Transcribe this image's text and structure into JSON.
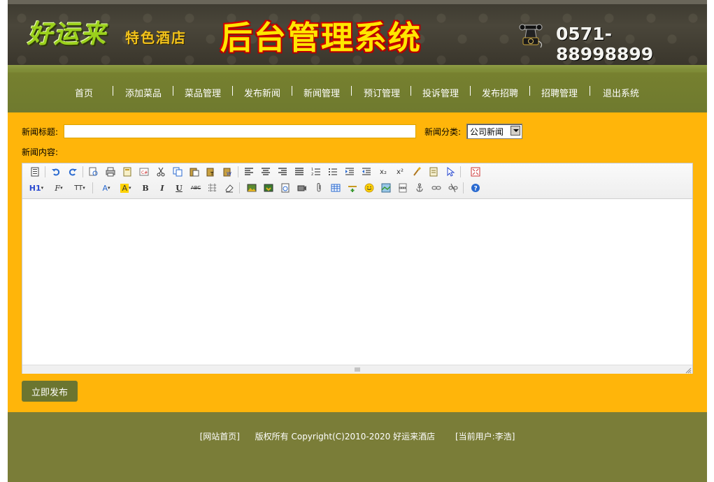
{
  "header": {
    "brand": "好运来",
    "brand_sub": "特色酒店",
    "system_title": "后台管理系统",
    "phone": "0571-88998899"
  },
  "nav": {
    "items": [
      {
        "label": "首页"
      },
      {
        "label": "添加菜品"
      },
      {
        "label": "菜品管理"
      },
      {
        "label": "发布新闻"
      },
      {
        "label": "新闻管理"
      },
      {
        "label": "预订管理"
      },
      {
        "label": "投诉管理"
      },
      {
        "label": "发布招聘"
      },
      {
        "label": "招聘管理"
      },
      {
        "label": "退出系统"
      }
    ]
  },
  "form": {
    "title_label": "新闻标题:",
    "title_value": "",
    "category_label": "新闻分类:",
    "category_value": "公司新闻",
    "content_label": "新闻内容:",
    "submit_label": "立即发布"
  },
  "editor_toolbar": {
    "row1": [
      "source-icon",
      "undo-icon",
      "redo-icon",
      "preview-icon",
      "print-icon",
      "template-icon",
      "code-icon",
      "cut-icon",
      "copy-icon",
      "paste-icon",
      "paste-text-icon",
      "paste-word-icon",
      "align-left-icon",
      "align-center-icon",
      "align-right-icon",
      "align-justify-icon",
      "ordered-list-icon",
      "unordered-list-icon",
      "indent-icon",
      "outdent-icon",
      "subscript-icon",
      "superscript-icon",
      "clear-format-icon",
      "select-all-icon",
      "cursor-icon",
      "fullscreen-icon"
    ],
    "row2": [
      "heading-icon",
      "font-family-icon",
      "font-size-icon",
      "font-color-icon",
      "highlight-icon",
      "bold-icon",
      "italic-icon",
      "underline-icon",
      "strikethrough-icon",
      "line-height-icon",
      "remove-format-icon",
      "image-icon",
      "multi-image-icon",
      "flash-icon",
      "media-icon",
      "attachment-icon",
      "table-icon",
      "hr-icon",
      "emoticon-icon",
      "map-icon",
      "pagebreak-icon",
      "anchor-icon",
      "link-icon",
      "unlink-icon",
      "help-icon"
    ],
    "glyphs": {
      "heading": "H1",
      "font_family": "F",
      "font_size": "TT",
      "font_color": "A",
      "highlight": "A",
      "bold": "B",
      "italic": "I",
      "underline": "U",
      "strikethrough": "ABC",
      "subscript": "x₂",
      "superscript": "x²"
    }
  },
  "footer": {
    "home_link": "[网站首页]",
    "copyright": "版权所有 Copyright(C)2010-2020 好运来酒店",
    "current_user": "[当前用户:李浩]"
  },
  "colors": {
    "main_bg": "#ffb50a",
    "nav_bg": "#76802f",
    "footer_bg": "#7a7d38",
    "button_bg": "#6b7530"
  }
}
